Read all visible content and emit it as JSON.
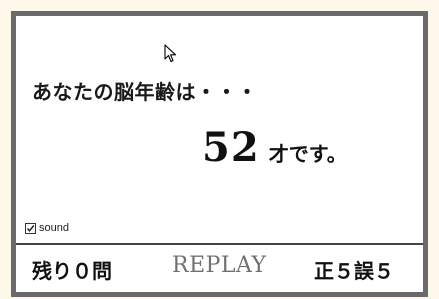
{
  "result": {
    "intro": "あなたの脳年齢は・・・",
    "age_value": "52",
    "age_suffix": "才です。"
  },
  "settings": {
    "sound_label": "sound",
    "sound_checked": true
  },
  "status": {
    "remaining": "残り０問",
    "replay_label": "REPLAY",
    "score": "正５誤５"
  },
  "colors": {
    "frame": "#6a6a6a",
    "background": "#fdf8ea",
    "replay_text": "#707070"
  }
}
